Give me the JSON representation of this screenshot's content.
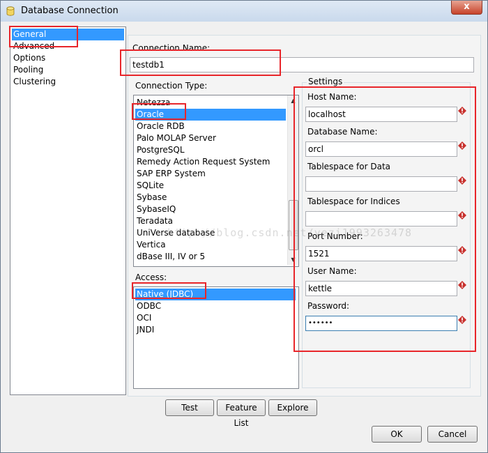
{
  "window": {
    "title": "Database Connection",
    "close_glyph": "x",
    "icon": "database-icon"
  },
  "sidebar": {
    "items": [
      {
        "label": "General",
        "selected": true
      },
      {
        "label": "Advanced"
      },
      {
        "label": "Options"
      },
      {
        "label": "Pooling"
      },
      {
        "label": "Clustering"
      }
    ]
  },
  "connection_name": {
    "label": "Connection Name:",
    "value": "testdb1"
  },
  "connection_type": {
    "label": "Connection Type:",
    "items": [
      {
        "label": "Netezza"
      },
      {
        "label": "Oracle",
        "selected": true
      },
      {
        "label": "Oracle RDB"
      },
      {
        "label": "Palo MOLAP Server"
      },
      {
        "label": "PostgreSQL"
      },
      {
        "label": "Remedy Action Request System"
      },
      {
        "label": "SAP ERP System"
      },
      {
        "label": "SQLite"
      },
      {
        "label": "Sybase"
      },
      {
        "label": "SybaseIQ"
      },
      {
        "label": "Teradata"
      },
      {
        "label": "UniVerse database"
      },
      {
        "label": "Vertica"
      },
      {
        "label": "dBase III, IV or 5"
      }
    ]
  },
  "access": {
    "label": "Access:",
    "items": [
      {
        "label": "Native (JDBC)",
        "selected": true
      },
      {
        "label": "ODBC"
      },
      {
        "label": "OCI"
      },
      {
        "label": "JNDI"
      }
    ]
  },
  "settings": {
    "title": "Settings",
    "fields": [
      {
        "label": "Host Name:",
        "value": "localhost"
      },
      {
        "label": "Database Name:",
        "value": "orcl"
      },
      {
        "label": "Tablespace for Data",
        "value": ""
      },
      {
        "label": "Tablespace for Indices",
        "value": ""
      },
      {
        "label": "Port Number:",
        "value": "1521"
      },
      {
        "label": "User Name:",
        "value": "kettle"
      },
      {
        "label": "Password:",
        "value": "••••••"
      }
    ],
    "variable_icon": "variable-diamond-icon"
  },
  "buttons": {
    "test": "Test",
    "feature_list": "Feature List",
    "explore": "Explore",
    "ok": "OK",
    "cancel": "Cancel"
  },
  "watermark": "http://blog.csdn.net/yezi1993263478",
  "colors": {
    "selection": "#3399ff",
    "annotation": "#e8252a",
    "focus_border": "#3c7fb1"
  }
}
